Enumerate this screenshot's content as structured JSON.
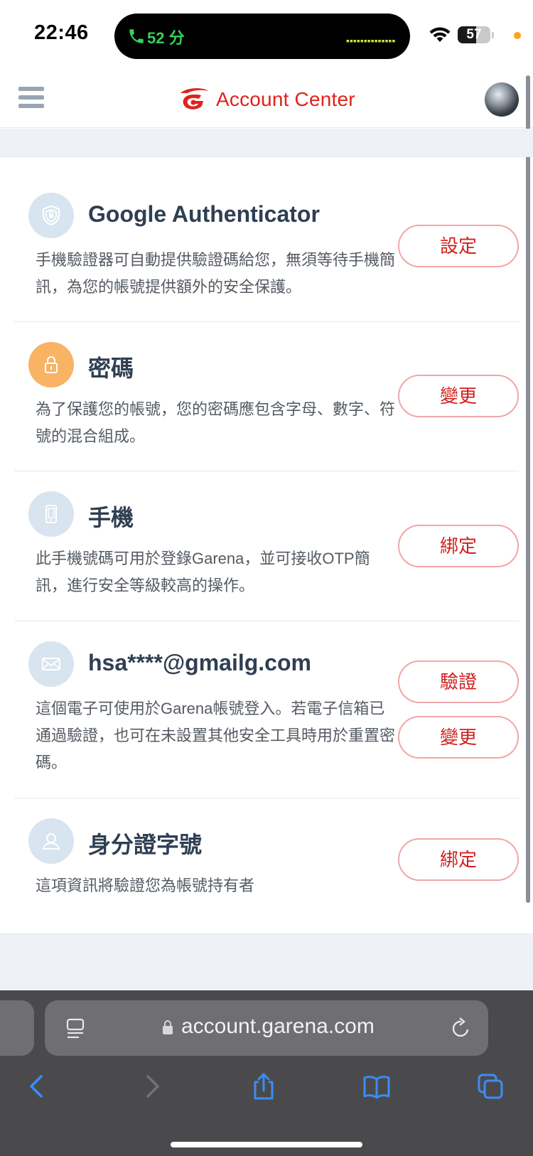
{
  "status_bar": {
    "time": "22:46",
    "call_duration": "52 分",
    "battery": "57",
    "battery_level": 0.57
  },
  "header": {
    "title": "Account Center"
  },
  "sections": [
    {
      "title": "Google Authenticator",
      "icon": "shield-icon",
      "description": "手機驗證器可自動提供驗證碼給您，無須等待手機簡訊，為您的帳號提供額外的安全保護。",
      "buttons": [
        "設定"
      ]
    },
    {
      "title": "密碼",
      "icon": "lock-icon",
      "description": "為了保護您的帳號，您的密碼應包含字母、數字、符號的混合組成。",
      "buttons": [
        "變更"
      ]
    },
    {
      "title": "手機",
      "icon": "phone-icon",
      "description": "此手機號碼可用於登錄Garena，並可接收OTP簡訊，進行安全等級較高的操作。",
      "buttons": [
        "綁定"
      ]
    },
    {
      "title": "hsa****@gmailg.com",
      "icon": "email-icon",
      "description": "這個電子可使用於Garena帳號登入。若電子信箱已通過驗證，也可在未設置其他安全工具時用於重置密碼。",
      "buttons": [
        "驗證",
        "變更"
      ]
    },
    {
      "title": "身分證字號",
      "icon": "id-person-icon",
      "description": "這項資訊將驗證您為帳號持有者",
      "buttons": [
        "綁定"
      ]
    }
  ],
  "browser": {
    "url": "account.garena.com"
  },
  "colors": {
    "brand_red": "#e0221b",
    "button_border": "#f2a7a7",
    "icon_bg": "#d8e4ef",
    "password_icon_bg": "#f8b365"
  }
}
